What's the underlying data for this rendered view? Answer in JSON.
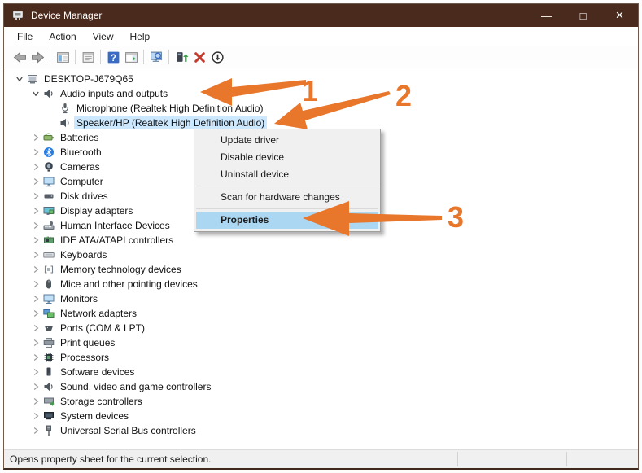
{
  "window": {
    "title": "Device Manager",
    "controls": {
      "minimize": "—",
      "maximize": "□",
      "close": "×"
    }
  },
  "menu_bar": {
    "items": [
      "File",
      "Action",
      "View",
      "Help"
    ]
  },
  "toolbar": {
    "buttons": [
      {
        "icon": "back-icon"
      },
      {
        "icon": "forward-icon"
      },
      {
        "divider": true
      },
      {
        "icon": "console-tree-icon"
      },
      {
        "divider": true
      },
      {
        "icon": "properties-panel-icon"
      },
      {
        "divider": true
      },
      {
        "icon": "help-icon"
      },
      {
        "icon": "action-pane-icon"
      },
      {
        "divider": true
      },
      {
        "icon": "scan-hardware-icon"
      },
      {
        "divider": true
      },
      {
        "icon": "update-driver-icon"
      },
      {
        "icon": "uninstall-device-icon"
      },
      {
        "icon": "disable-device-icon"
      }
    ]
  },
  "tree": {
    "items": [
      {
        "label": "DESKTOP-J679Q65",
        "level": 0,
        "state": "expanded",
        "icon": "computer-icon"
      },
      {
        "label": "Audio inputs and outputs",
        "level": 1,
        "state": "expanded",
        "icon": "audio-icon"
      },
      {
        "label": "Microphone (Realtek High Definition Audio)",
        "level": 2,
        "state": "leaf",
        "icon": "microphone-icon"
      },
      {
        "label": "Speaker/HP (Realtek High Definition Audio)",
        "level": 2,
        "state": "leaf",
        "icon": "speaker-icon",
        "selected": true
      },
      {
        "label": "Batteries",
        "level": 1,
        "state": "collapsed",
        "icon": "battery-icon"
      },
      {
        "label": "Bluetooth",
        "level": 1,
        "state": "collapsed",
        "icon": "bluetooth-icon"
      },
      {
        "label": "Cameras",
        "level": 1,
        "state": "collapsed",
        "icon": "camera-icon"
      },
      {
        "label": "Computer",
        "level": 1,
        "state": "collapsed",
        "icon": "monitor-icon"
      },
      {
        "label": "Disk drives",
        "level": 1,
        "state": "collapsed",
        "icon": "disk-icon"
      },
      {
        "label": "Display adapters",
        "level": 1,
        "state": "collapsed",
        "icon": "display-adapter-icon"
      },
      {
        "label": "Human Interface Devices",
        "level": 1,
        "state": "collapsed",
        "icon": "hid-icon"
      },
      {
        "label": "IDE ATA/ATAPI controllers",
        "level": 1,
        "state": "collapsed",
        "icon": "ide-controller-icon"
      },
      {
        "label": "Keyboards",
        "level": 1,
        "state": "collapsed",
        "icon": "keyboard-icon"
      },
      {
        "label": "Memory technology devices",
        "level": 1,
        "state": "collapsed",
        "icon": "memory-icon"
      },
      {
        "label": "Mice and other pointing devices",
        "level": 1,
        "state": "collapsed",
        "icon": "mouse-icon"
      },
      {
        "label": "Monitors",
        "level": 1,
        "state": "collapsed",
        "icon": "monitor-icon"
      },
      {
        "label": "Network adapters",
        "level": 1,
        "state": "collapsed",
        "icon": "network-icon"
      },
      {
        "label": "Ports (COM & LPT)",
        "level": 1,
        "state": "collapsed",
        "icon": "ports-icon"
      },
      {
        "label": "Print queues",
        "level": 1,
        "state": "collapsed",
        "icon": "printer-icon"
      },
      {
        "label": "Processors",
        "level": 1,
        "state": "collapsed",
        "icon": "processor-icon"
      },
      {
        "label": "Software devices",
        "level": 1,
        "state": "collapsed",
        "icon": "software-icon"
      },
      {
        "label": "Sound, video and game controllers",
        "level": 1,
        "state": "collapsed",
        "icon": "sound-icon"
      },
      {
        "label": "Storage controllers",
        "level": 1,
        "state": "collapsed",
        "icon": "storage-icon"
      },
      {
        "label": "System devices",
        "level": 1,
        "state": "collapsed",
        "icon": "system-icon"
      },
      {
        "label": "Universal Serial Bus controllers",
        "level": 1,
        "state": "collapsed",
        "icon": "usb-icon"
      }
    ]
  },
  "context_menu": {
    "items": [
      {
        "label": "Update driver"
      },
      {
        "label": "Disable device"
      },
      {
        "label": "Uninstall device"
      },
      {
        "divider": true
      },
      {
        "label": "Scan for hardware changes"
      },
      {
        "divider": true
      },
      {
        "label": "Properties",
        "highlighted": true
      }
    ]
  },
  "status_bar": {
    "text": "Opens property sheet for the current selection."
  },
  "annotations": {
    "arrow_color": "#e8762b",
    "steps": [
      {
        "label": "1"
      },
      {
        "label": "2"
      },
      {
        "label": "3"
      }
    ]
  },
  "colors": {
    "title_bar": "#4a2a1c",
    "selection": "#cce8ff",
    "menu_highlight": "#abd7f3",
    "status_bar": "#f0f0f0",
    "accent_orange": "#e8762b"
  }
}
